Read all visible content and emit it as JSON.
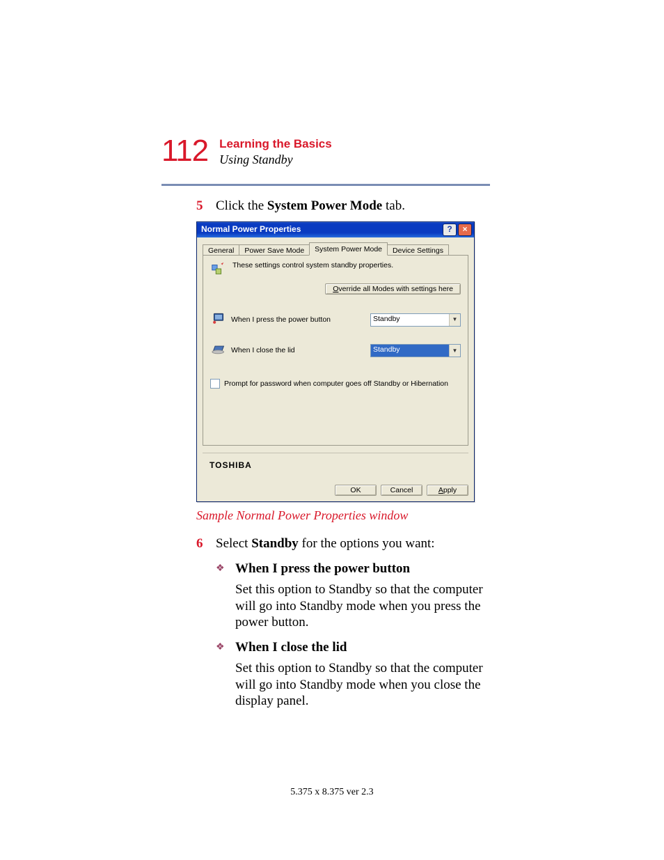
{
  "header": {
    "page_number": "112",
    "chapter": "Learning the Basics",
    "section": "Using Standby"
  },
  "steps": {
    "s5": {
      "num": "5",
      "prefix": "Click the ",
      "bold": "System Power Mode",
      "suffix": " tab."
    },
    "s6": {
      "num": "6",
      "prefix": "Select ",
      "bold": "Standby",
      "suffix": " for the options you want:"
    }
  },
  "caption": "Sample Normal Power Properties window",
  "bullets": {
    "b1": {
      "title": "When I press the power button",
      "desc": "Set this option to Standby so that the computer will go into Standby mode when you press the power button."
    },
    "b2": {
      "title": "When I close the lid",
      "desc": "Set this option to Standby so that the computer will go into Standby mode when you close the display panel."
    }
  },
  "dialog": {
    "title": "Normal Power Properties",
    "help_btn": "?",
    "close_btn": "×",
    "tabs": {
      "general": "General",
      "power_save": "Power Save Mode",
      "system_power": "System Power Mode",
      "device": "Device Settings"
    },
    "description": "These settings control system standby properties.",
    "override_btn": "Override all Modes with settings here",
    "option1": {
      "label": "When I press the power button",
      "value": "Standby"
    },
    "option2": {
      "label": "When I close the lid",
      "value": "Standby"
    },
    "checkbox_label": "Prompt for password when computer goes off Standby or Hibernation",
    "brand": "TOSHIBA",
    "ok": "OK",
    "cancel": "Cancel",
    "apply": "Apply"
  },
  "footer": "5.375 x 8.375 ver 2.3"
}
